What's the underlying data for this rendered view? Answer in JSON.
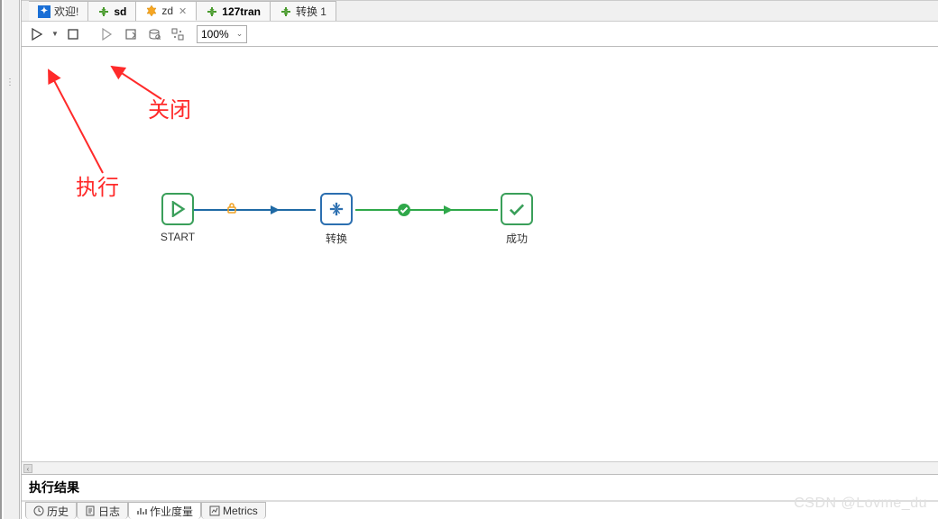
{
  "tabs": [
    {
      "label": "欢迎!",
      "icon": "welcome",
      "bold": false
    },
    {
      "label": "sd",
      "icon": "trans",
      "bold": true
    },
    {
      "label": "zd",
      "icon": "job",
      "bold": false,
      "closable": true
    },
    {
      "label": "127tran",
      "icon": "trans",
      "bold": true
    },
    {
      "label": "转换 1",
      "icon": "trans",
      "bold": false
    }
  ],
  "toolbar": {
    "run_tooltip": "执行",
    "stop_tooltip": "关闭",
    "zoom_value": "100%"
  },
  "annotations": {
    "run_label": "执行",
    "stop_label": "关闭"
  },
  "nodes": {
    "start": {
      "label": "START"
    },
    "trans": {
      "label": "转换"
    },
    "success": {
      "label": "成功"
    }
  },
  "results": {
    "header": "执行结果",
    "tabs": [
      {
        "label": "历史",
        "icon": "clock"
      },
      {
        "label": "日志",
        "icon": "doc"
      },
      {
        "label": "作业度量",
        "icon": "metrics"
      },
      {
        "label": "Metrics",
        "icon": "metrics2"
      }
    ],
    "active_tab_index": 2
  },
  "watermark": "CSDN @Lovme_du"
}
